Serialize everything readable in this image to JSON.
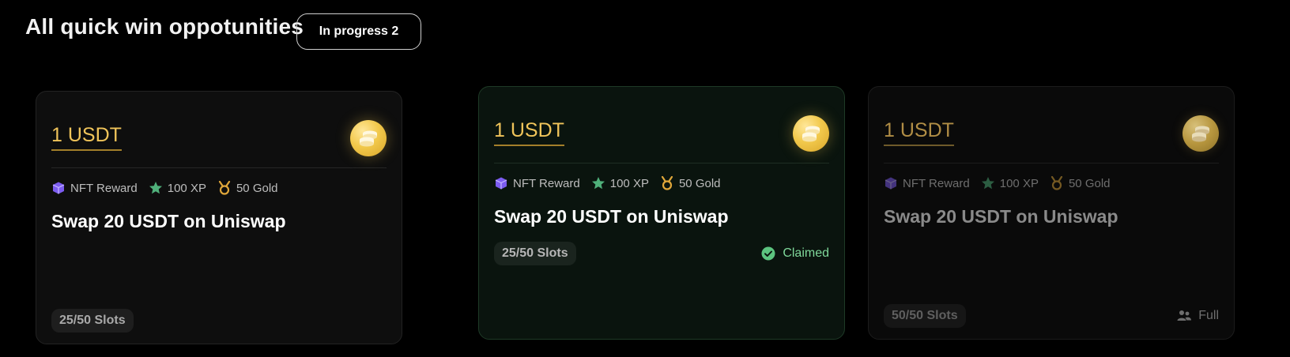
{
  "header": {
    "title": "All quick win oppotunities",
    "filter_label": "In progress 2"
  },
  "colors": {
    "background": "#000000",
    "accent_gold": "#f0c45a",
    "claimed_green": "#7fd89a",
    "nft_purple": "#7c5cf0",
    "xp_green": "#4fb07a",
    "gold_medal": "#e0a73a"
  },
  "cards": [
    {
      "amount": "1 USDT",
      "rewards": [
        {
          "icon": "cube-icon",
          "label": "NFT Reward"
        },
        {
          "icon": "star-icon",
          "label": "100 XP"
        },
        {
          "icon": "medal-icon",
          "label": "50 Gold"
        }
      ],
      "title": "Swap 20 USDT on Uniswap",
      "slots": "25/50 Slots",
      "status": ""
    },
    {
      "amount": "1 USDT",
      "rewards": [
        {
          "icon": "cube-icon",
          "label": "NFT Reward"
        },
        {
          "icon": "star-icon",
          "label": "100 XP"
        },
        {
          "icon": "medal-icon",
          "label": "50 Gold"
        }
      ],
      "title": "Swap 20 USDT on Uniswap",
      "slots": "25/50 Slots",
      "status": "Claimed"
    },
    {
      "amount": "1 USDT",
      "rewards": [
        {
          "icon": "cube-icon",
          "label": "NFT Reward"
        },
        {
          "icon": "star-icon",
          "label": "100 XP"
        },
        {
          "icon": "medal-icon",
          "label": "50 Gold"
        }
      ],
      "title": "Swap 20 USDT on Uniswap",
      "slots": "50/50 Slots",
      "status": "Full"
    }
  ]
}
